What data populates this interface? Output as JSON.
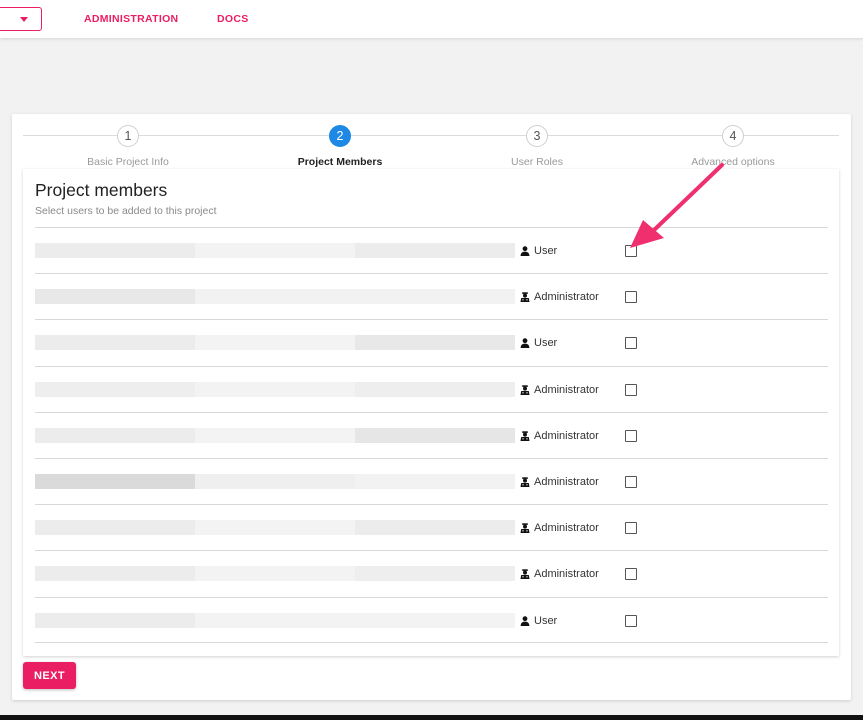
{
  "nav": {
    "links": [
      "ADMINISTRATION",
      "DOCS"
    ]
  },
  "stepper": {
    "steps": [
      {
        "number": "1",
        "label": "Basic Project Info"
      },
      {
        "number": "2",
        "label": "Project Members"
      },
      {
        "number": "3",
        "label": "User Roles"
      },
      {
        "number": "4",
        "label": "Advanced options"
      }
    ],
    "active_step": 2
  },
  "panel": {
    "title": "Project members",
    "subtitle": "Select users to be added to this project"
  },
  "members": [
    {
      "role": "User",
      "role_icon": "person-icon",
      "checked": false
    },
    {
      "role": "Administrator",
      "role_icon": "admin-icon",
      "checked": false
    },
    {
      "role": "User",
      "role_icon": "person-icon",
      "checked": false
    },
    {
      "role": "Administrator",
      "role_icon": "admin-icon",
      "checked": false
    },
    {
      "role": "Administrator",
      "role_icon": "admin-icon",
      "checked": false
    },
    {
      "role": "Administrator",
      "role_icon": "admin-icon",
      "checked": false
    },
    {
      "role": "Administrator",
      "role_icon": "admin-icon",
      "checked": false
    },
    {
      "role": "Administrator",
      "role_icon": "admin-icon",
      "checked": false
    },
    {
      "role": "User",
      "role_icon": "person-icon",
      "checked": false
    }
  ],
  "actions": {
    "next_label": "NEXT"
  },
  "colors": {
    "accent": "#e91e63",
    "step_active": "#1e88e5"
  }
}
